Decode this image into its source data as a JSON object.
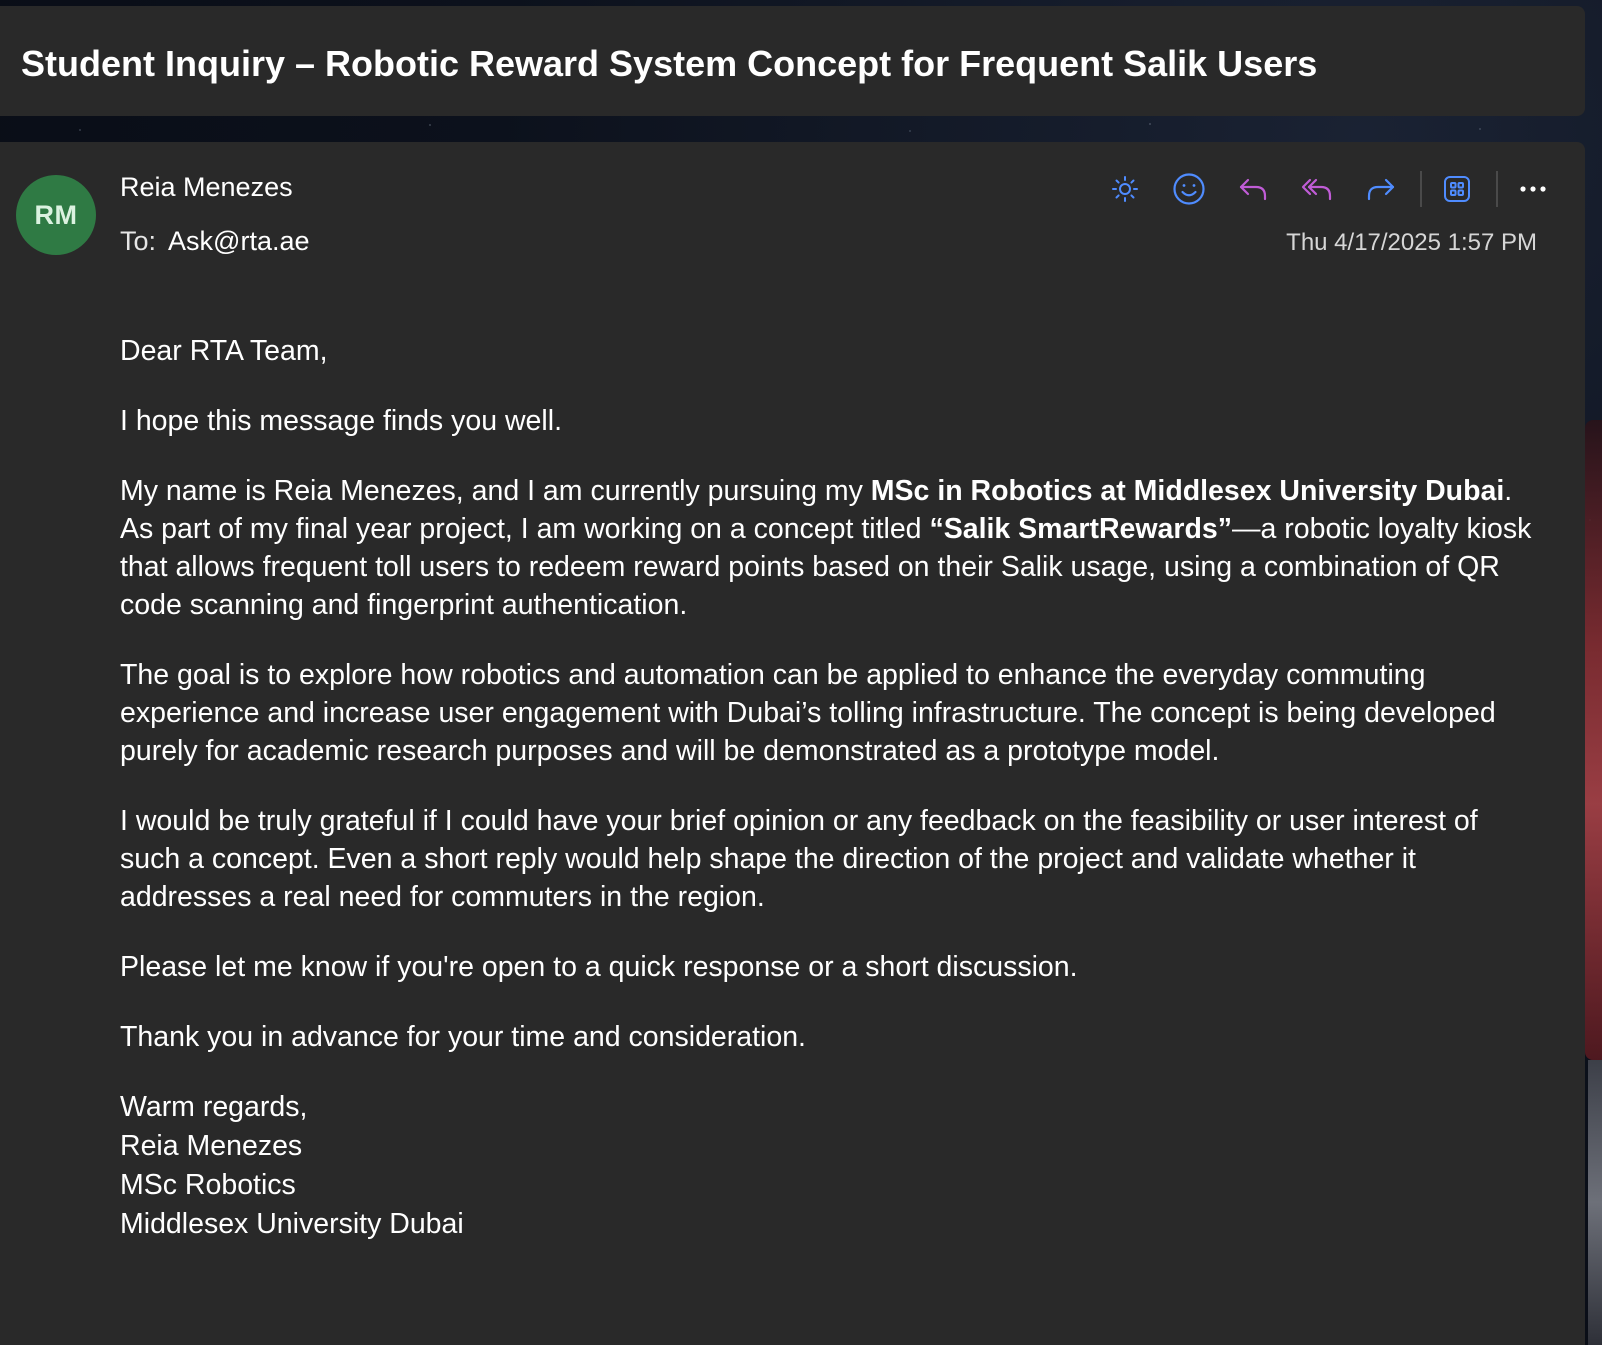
{
  "subject": "Student Inquiry – Robotic Reward System Concept for Frequent Salik Users",
  "sender": {
    "initials": "RM",
    "name": "Reia Menezes",
    "avatar_color": "#2f7a44"
  },
  "recipient": {
    "label": "To:",
    "address": "Ask@rta.ae"
  },
  "sent_time": "Thu 4/17/2025 1:57 PM",
  "actions": [
    {
      "name": "summarize",
      "icon": "sun-icon",
      "color": "#4f8cff"
    },
    {
      "name": "react",
      "icon": "smiley-icon",
      "color": "#4f8cff"
    },
    {
      "name": "reply",
      "icon": "reply-icon",
      "color": "#c05cd6"
    },
    {
      "name": "reply-all",
      "icon": "reply-all-icon",
      "color": "#c05cd6"
    },
    {
      "name": "forward",
      "icon": "forward-icon",
      "color": "#4f8cff"
    },
    {
      "name": "apps",
      "icon": "apps-grid-icon",
      "color": "#4f8cff"
    },
    {
      "name": "more",
      "icon": "more-icon",
      "color": "#ffffff"
    }
  ],
  "body": {
    "greeting": "Dear RTA Team,",
    "p1": "I hope this message finds you well.",
    "p2": {
      "t1": "My name is Reia Menezes, and I am currently pursuing my ",
      "b1": "MSc in Robotics at Middlesex University Dubai",
      "t2": ". As part of my final year project, I am working on a concept titled ",
      "b2": "“Salik SmartRewards”",
      "t3": "—a robotic loyalty kiosk that allows frequent toll users to redeem reward points based on their Salik usage, using a combination of QR code scanning and fingerprint authentication."
    },
    "p3": "The goal is to explore how robotics and automation can be applied to enhance the everyday commuting experience and increase user engagement with Dubai’s tolling infrastructure. The concept is being developed purely for academic research purposes and will be demonstrated as a prototype model.",
    "p4": "I would be truly grateful if I could have your brief opinion or any feedback on the feasibility or user interest of such a concept. Even a short reply would help shape the direction of the project and validate whether it addresses a real need for commuters in the region.",
    "p5": "Please let me know if you're open to a quick response or a short discussion.",
    "p6": "Thank you in advance for your time and consideration.",
    "signature": {
      "closing": "Warm regards,",
      "name": "Reia Menezes",
      "program": "MSc Robotics",
      "university": "Middlesex University Dubai"
    }
  }
}
